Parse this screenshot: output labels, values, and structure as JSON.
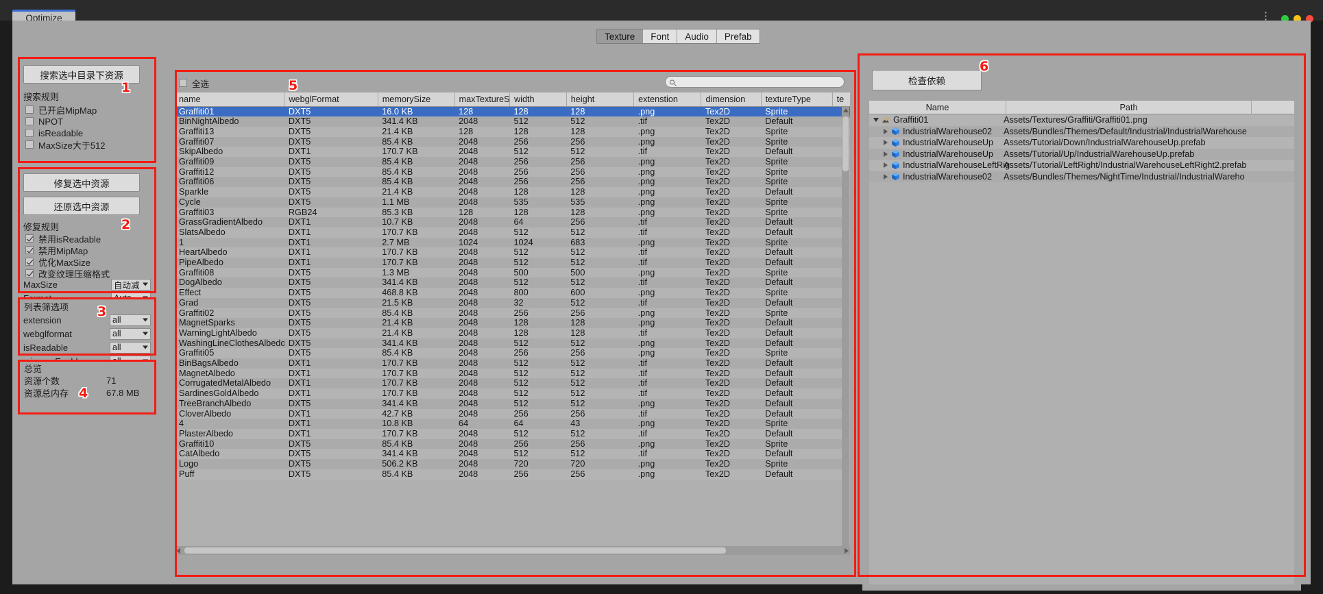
{
  "window": {
    "tab_title": "Optimize",
    "kebab_icon": "more-options-icon"
  },
  "toolbar": {
    "tabs": [
      {
        "label": "Texture",
        "selected": true
      },
      {
        "label": "Font",
        "selected": false
      },
      {
        "label": "Audio",
        "selected": false
      },
      {
        "label": "Prefab",
        "selected": false
      }
    ]
  },
  "annotations": [
    {
      "number": "1"
    },
    {
      "number": "2"
    },
    {
      "number": "3"
    },
    {
      "number": "4"
    },
    {
      "number": "5"
    },
    {
      "number": "6"
    }
  ],
  "search_panel": {
    "button": "搜索选中目录下资源",
    "rules_label": "搜索规则",
    "rules": [
      {
        "label": "已开启MipMap",
        "checked": false
      },
      {
        "label": "NPOT",
        "checked": false
      },
      {
        "label": "isReadable",
        "checked": false
      },
      {
        "label": "MaxSize大于512",
        "checked": false
      }
    ]
  },
  "fix_panel": {
    "fix_button": "修复选中资源",
    "revert_button": "还原选中资源",
    "rules_label": "修复规则",
    "rules": [
      {
        "label": "禁用isReadable",
        "checked": true
      },
      {
        "label": "禁用MipMap",
        "checked": true
      },
      {
        "label": "优化MaxSize",
        "checked": true
      },
      {
        "label": "改变纹理压缩格式",
        "checked": true
      }
    ],
    "fields": [
      {
        "label": "MaxSize",
        "value": "自动减"
      },
      {
        "label": "Format",
        "value": "Auto"
      }
    ]
  },
  "filter_panel": {
    "title": "列表筛选项",
    "filters": [
      {
        "label": "extension",
        "value": "all"
      },
      {
        "label": "webglformat",
        "value": "all"
      },
      {
        "label": "isReadable",
        "value": "all"
      },
      {
        "label": "mipmapEnable",
        "value": "all"
      }
    ]
  },
  "overview_panel": {
    "title": "总览",
    "rows": [
      {
        "key": "资源个数",
        "value": "71"
      },
      {
        "key": "资源总内存",
        "value": "67.8 MB"
      }
    ]
  },
  "table_panel": {
    "select_all_label": "全选",
    "select_all_checked": false,
    "search_placeholder": "",
    "search_value": "",
    "columns": [
      "name",
      "webglFormat",
      "memorySize",
      "maxTextureSiz",
      "width",
      "height",
      "extenstion",
      "dimension",
      "textureType",
      "te"
    ],
    "rows": [
      {
        "name": "Graffiti01",
        "webglFormat": "DXT5",
        "memorySize": "16.0 KB",
        "maxTextureSize": "128",
        "width": "128",
        "height": "128",
        "extenstion": ".png",
        "dimension": "Tex2D",
        "textureType": "Sprite",
        "te": "",
        "selected": true
      },
      {
        "name": "BinNightAlbedo",
        "webglFormat": "DXT5",
        "memorySize": "341.4 KB",
        "maxTextureSize": "2048",
        "width": "512",
        "height": "512",
        "extenstion": ".tif",
        "dimension": "Tex2D",
        "textureType": "Default",
        "te": "",
        "selected": false
      },
      {
        "name": "Graffiti13",
        "webglFormat": "DXT5",
        "memorySize": "21.4 KB",
        "maxTextureSize": "128",
        "width": "128",
        "height": "128",
        "extenstion": ".png",
        "dimension": "Tex2D",
        "textureType": "Sprite",
        "te": "",
        "selected": false
      },
      {
        "name": "Graffiti07",
        "webglFormat": "DXT5",
        "memorySize": "85.4 KB",
        "maxTextureSize": "2048",
        "width": "256",
        "height": "256",
        "extenstion": ".png",
        "dimension": "Tex2D",
        "textureType": "Sprite",
        "te": "",
        "selected": false
      },
      {
        "name": "SkipAlbedo",
        "webglFormat": "DXT1",
        "memorySize": "170.7 KB",
        "maxTextureSize": "2048",
        "width": "512",
        "height": "512",
        "extenstion": ".tif",
        "dimension": "Tex2D",
        "textureType": "Default",
        "te": "",
        "selected": false
      },
      {
        "name": "Graffiti09",
        "webglFormat": "DXT5",
        "memorySize": "85.4 KB",
        "maxTextureSize": "2048",
        "width": "256",
        "height": "256",
        "extenstion": ".png",
        "dimension": "Tex2D",
        "textureType": "Sprite",
        "te": "",
        "selected": false
      },
      {
        "name": "Graffiti12",
        "webglFormat": "DXT5",
        "memorySize": "85.4 KB",
        "maxTextureSize": "2048",
        "width": "256",
        "height": "256",
        "extenstion": ".png",
        "dimension": "Tex2D",
        "textureType": "Sprite",
        "te": "",
        "selected": false
      },
      {
        "name": "Graffiti06",
        "webglFormat": "DXT5",
        "memorySize": "85.4 KB",
        "maxTextureSize": "2048",
        "width": "256",
        "height": "256",
        "extenstion": ".png",
        "dimension": "Tex2D",
        "textureType": "Sprite",
        "te": "",
        "selected": false
      },
      {
        "name": "Sparkle",
        "webglFormat": "DXT5",
        "memorySize": "21.4 KB",
        "maxTextureSize": "2048",
        "width": "128",
        "height": "128",
        "extenstion": ".png",
        "dimension": "Tex2D",
        "textureType": "Default",
        "te": "",
        "selected": false
      },
      {
        "name": "Cycle",
        "webglFormat": "DXT5",
        "memorySize": "1.1 MB",
        "maxTextureSize": "2048",
        "width": "535",
        "height": "535",
        "extenstion": ".png",
        "dimension": "Tex2D",
        "textureType": "Sprite",
        "te": "",
        "selected": false
      },
      {
        "name": "Graffiti03",
        "webglFormat": "RGB24",
        "memorySize": "85.3 KB",
        "maxTextureSize": "128",
        "width": "128",
        "height": "128",
        "extenstion": ".png",
        "dimension": "Tex2D",
        "textureType": "Sprite",
        "te": "",
        "selected": false
      },
      {
        "name": "GrassGradientAlbedo",
        "webglFormat": "DXT1",
        "memorySize": "10.7 KB",
        "maxTextureSize": "2048",
        "width": "64",
        "height": "256",
        "extenstion": ".tif",
        "dimension": "Tex2D",
        "textureType": "Default",
        "te": "",
        "selected": false
      },
      {
        "name": "SlatsAlbedo",
        "webglFormat": "DXT1",
        "memorySize": "170.7 KB",
        "maxTextureSize": "2048",
        "width": "512",
        "height": "512",
        "extenstion": ".tif",
        "dimension": "Tex2D",
        "textureType": "Default",
        "te": "",
        "selected": false
      },
      {
        "name": "1",
        "webglFormat": "DXT1",
        "memorySize": "2.7 MB",
        "maxTextureSize": "1024",
        "width": "1024",
        "height": "683",
        "extenstion": ".png",
        "dimension": "Tex2D",
        "textureType": "Sprite",
        "te": "",
        "selected": false
      },
      {
        "name": "HeartAlbedo",
        "webglFormat": "DXT1",
        "memorySize": "170.7 KB",
        "maxTextureSize": "2048",
        "width": "512",
        "height": "512",
        "extenstion": ".tif",
        "dimension": "Tex2D",
        "textureType": "Default",
        "te": "",
        "selected": false
      },
      {
        "name": "PipeAlbedo",
        "webglFormat": "DXT1",
        "memorySize": "170.7 KB",
        "maxTextureSize": "2048",
        "width": "512",
        "height": "512",
        "extenstion": ".tif",
        "dimension": "Tex2D",
        "textureType": "Default",
        "te": "",
        "selected": false
      },
      {
        "name": "Graffiti08",
        "webglFormat": "DXT5",
        "memorySize": "1.3 MB",
        "maxTextureSize": "2048",
        "width": "500",
        "height": "500",
        "extenstion": ".png",
        "dimension": "Tex2D",
        "textureType": "Sprite",
        "te": "",
        "selected": false
      },
      {
        "name": "DogAlbedo",
        "webglFormat": "DXT5",
        "memorySize": "341.4 KB",
        "maxTextureSize": "2048",
        "width": "512",
        "height": "512",
        "extenstion": ".tif",
        "dimension": "Tex2D",
        "textureType": "Default",
        "te": "",
        "selected": false
      },
      {
        "name": "Effect",
        "webglFormat": "DXT5",
        "memorySize": "468.8 KB",
        "maxTextureSize": "2048",
        "width": "800",
        "height": "600",
        "extenstion": ".png",
        "dimension": "Tex2D",
        "textureType": "Sprite",
        "te": "",
        "selected": false
      },
      {
        "name": "Grad",
        "webglFormat": "DXT5",
        "memorySize": "21.5 KB",
        "maxTextureSize": "2048",
        "width": "32",
        "height": "512",
        "extenstion": ".tif",
        "dimension": "Tex2D",
        "textureType": "Default",
        "te": "",
        "selected": false
      },
      {
        "name": "Graffiti02",
        "webglFormat": "DXT5",
        "memorySize": "85.4 KB",
        "maxTextureSize": "2048",
        "width": "256",
        "height": "256",
        "extenstion": ".png",
        "dimension": "Tex2D",
        "textureType": "Sprite",
        "te": "",
        "selected": false
      },
      {
        "name": "MagnetSparks",
        "webglFormat": "DXT5",
        "memorySize": "21.4 KB",
        "maxTextureSize": "2048",
        "width": "128",
        "height": "128",
        "extenstion": ".png",
        "dimension": "Tex2D",
        "textureType": "Default",
        "te": "",
        "selected": false
      },
      {
        "name": "WarningLightAlbedo",
        "webglFormat": "DXT5",
        "memorySize": "21.4 KB",
        "maxTextureSize": "2048",
        "width": "128",
        "height": "128",
        "extenstion": ".tif",
        "dimension": "Tex2D",
        "textureType": "Default",
        "te": "",
        "selected": false
      },
      {
        "name": "WashingLineClothesAlbedo",
        "webglFormat": "DXT5",
        "memorySize": "341.4 KB",
        "maxTextureSize": "2048",
        "width": "512",
        "height": "512",
        "extenstion": ".png",
        "dimension": "Tex2D",
        "textureType": "Default",
        "te": "",
        "selected": false
      },
      {
        "name": "Graffiti05",
        "webglFormat": "DXT5",
        "memorySize": "85.4 KB",
        "maxTextureSize": "2048",
        "width": "256",
        "height": "256",
        "extenstion": ".png",
        "dimension": "Tex2D",
        "textureType": "Sprite",
        "te": "",
        "selected": false
      },
      {
        "name": "BinBagsAlbedo",
        "webglFormat": "DXT1",
        "memorySize": "170.7 KB",
        "maxTextureSize": "2048",
        "width": "512",
        "height": "512",
        "extenstion": ".tif",
        "dimension": "Tex2D",
        "textureType": "Default",
        "te": "",
        "selected": false
      },
      {
        "name": "MagnetAlbedo",
        "webglFormat": "DXT1",
        "memorySize": "170.7 KB",
        "maxTextureSize": "2048",
        "width": "512",
        "height": "512",
        "extenstion": ".tif",
        "dimension": "Tex2D",
        "textureType": "Default",
        "te": "",
        "selected": false
      },
      {
        "name": "CorrugatedMetalAlbedo",
        "webglFormat": "DXT1",
        "memorySize": "170.7 KB",
        "maxTextureSize": "2048",
        "width": "512",
        "height": "512",
        "extenstion": ".tif",
        "dimension": "Tex2D",
        "textureType": "Default",
        "te": "",
        "selected": false
      },
      {
        "name": "SardinesGoldAlbedo",
        "webglFormat": "DXT1",
        "memorySize": "170.7 KB",
        "maxTextureSize": "2048",
        "width": "512",
        "height": "512",
        "extenstion": ".tif",
        "dimension": "Tex2D",
        "textureType": "Default",
        "te": "",
        "selected": false
      },
      {
        "name": "TreeBranchAlbedo",
        "webglFormat": "DXT5",
        "memorySize": "341.4 KB",
        "maxTextureSize": "2048",
        "width": "512",
        "height": "512",
        "extenstion": ".png",
        "dimension": "Tex2D",
        "textureType": "Default",
        "te": "",
        "selected": false
      },
      {
        "name": "CloverAlbedo",
        "webglFormat": "DXT1",
        "memorySize": "42.7 KB",
        "maxTextureSize": "2048",
        "width": "256",
        "height": "256",
        "extenstion": ".tif",
        "dimension": "Tex2D",
        "textureType": "Default",
        "te": "",
        "selected": false
      },
      {
        "name": "4",
        "webglFormat": "DXT1",
        "memorySize": "10.8 KB",
        "maxTextureSize": "64",
        "width": "64",
        "height": "43",
        "extenstion": ".png",
        "dimension": "Tex2D",
        "textureType": "Sprite",
        "te": "",
        "selected": false
      },
      {
        "name": "PlasterAlbedo",
        "webglFormat": "DXT1",
        "memorySize": "170.7 KB",
        "maxTextureSize": "2048",
        "width": "512",
        "height": "512",
        "extenstion": ".tif",
        "dimension": "Tex2D",
        "textureType": "Default",
        "te": "",
        "selected": false
      },
      {
        "name": "Graffiti10",
        "webglFormat": "DXT5",
        "memorySize": "85.4 KB",
        "maxTextureSize": "2048",
        "width": "256",
        "height": "256",
        "extenstion": ".png",
        "dimension": "Tex2D",
        "textureType": "Sprite",
        "te": "",
        "selected": false
      },
      {
        "name": "CatAlbedo",
        "webglFormat": "DXT5",
        "memorySize": "341.4 KB",
        "maxTextureSize": "2048",
        "width": "512",
        "height": "512",
        "extenstion": ".tif",
        "dimension": "Tex2D",
        "textureType": "Default",
        "te": "",
        "selected": false
      },
      {
        "name": "Logo",
        "webglFormat": "DXT5",
        "memorySize": "506.2 KB",
        "maxTextureSize": "2048",
        "width": "720",
        "height": "720",
        "extenstion": ".png",
        "dimension": "Tex2D",
        "textureType": "Sprite",
        "te": "",
        "selected": false
      },
      {
        "name": "Puff",
        "webglFormat": "DXT5",
        "memorySize": "85.4 KB",
        "maxTextureSize": "2048",
        "width": "256",
        "height": "256",
        "extenstion": ".png",
        "dimension": "Tex2D",
        "textureType": "Default",
        "te": "",
        "selected": false
      }
    ]
  },
  "dependency_panel": {
    "button": "检查依赖",
    "columns": [
      "Name",
      "Path",
      ""
    ],
    "rows": [
      {
        "name": "Graffiti01",
        "path": "Assets/Textures/Graffiti/Graffiti01.png",
        "depth": 0,
        "expanded": true,
        "icon": "texture-asset-icon"
      },
      {
        "name": "IndustrialWarehouse02",
        "path": "Assets/Bundles/Themes/Default/Industrial/IndustrialWarehouse",
        "depth": 1,
        "expanded": false,
        "icon": "prefab-cube-icon"
      },
      {
        "name": "IndustrialWarehouseUp",
        "path": "Assets/Tutorial/Down/IndustrialWarehouseUp.prefab",
        "depth": 1,
        "expanded": false,
        "icon": "prefab-cube-icon"
      },
      {
        "name": "IndustrialWarehouseUp",
        "path": "Assets/Tutorial/Up/IndustrialWarehouseUp.prefab",
        "depth": 1,
        "expanded": false,
        "icon": "prefab-cube-icon"
      },
      {
        "name": "IndustrialWarehouseLeftRig",
        "path": "Assets/Tutorial/LeftRight/IndustrialWarehouseLeftRight2.prefab",
        "depth": 1,
        "expanded": false,
        "icon": "prefab-cube-icon"
      },
      {
        "name": "IndustrialWarehouse02",
        "path": "Assets/Bundles/Themes/NightTime/Industrial/IndustrialWareho",
        "depth": 1,
        "expanded": false,
        "icon": "prefab-cube-icon"
      }
    ]
  },
  "colors": {
    "annotation": "#f41b12",
    "selection": "#3a6cc4",
    "panel_bg": "#a5a5a5",
    "row_even": "#b4b4b4",
    "row_odd": "#ababab"
  }
}
